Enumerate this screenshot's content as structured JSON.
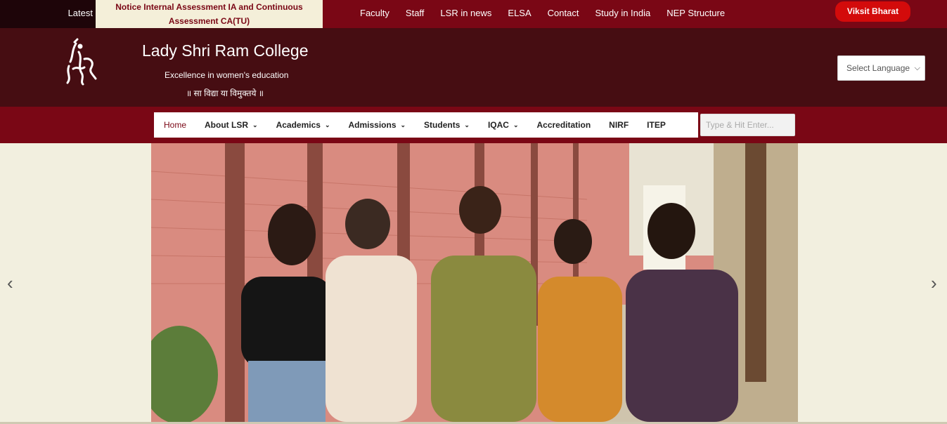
{
  "topbar": {
    "latest_label": "Latest",
    "ticker_text": "Notice Internal Assessment IA and Continuous Assessment CA(TU)",
    "links": [
      "Faculty",
      "Staff",
      "LSR in news",
      "ELSA",
      "Contact",
      "Study in India",
      "NEP Structure"
    ],
    "cta_label": "Viksit Bharat"
  },
  "header": {
    "site_title": "Lady Shri Ram College",
    "tagline": "Excellence in women's education",
    "motto": "॥ सा विद्या या विमुक्तये ॥",
    "language_select": "Select Language"
  },
  "nav": {
    "items": [
      {
        "label": "Home",
        "active": true,
        "has_dropdown": false
      },
      {
        "label": "About LSR",
        "has_dropdown": true
      },
      {
        "label": "Academics",
        "has_dropdown": true
      },
      {
        "label": "Admissions",
        "has_dropdown": true
      },
      {
        "label": "Students",
        "has_dropdown": true
      },
      {
        "label": "IQAC",
        "has_dropdown": true
      },
      {
        "label": "Accreditation",
        "has_dropdown": false
      },
      {
        "label": "NIRF",
        "has_dropdown": false
      },
      {
        "label": "ITEP",
        "has_dropdown": false
      }
    ],
    "search_placeholder": "Type & Hit Enter..."
  },
  "slider": {
    "prev_icon": "chevron-left-icon",
    "next_icon": "chevron-right-icon"
  },
  "colors": {
    "maroon": "#7a0715",
    "dark_maroon": "#460d12",
    "cream": "#f2efdf",
    "cta_red": "#d30b0b"
  }
}
